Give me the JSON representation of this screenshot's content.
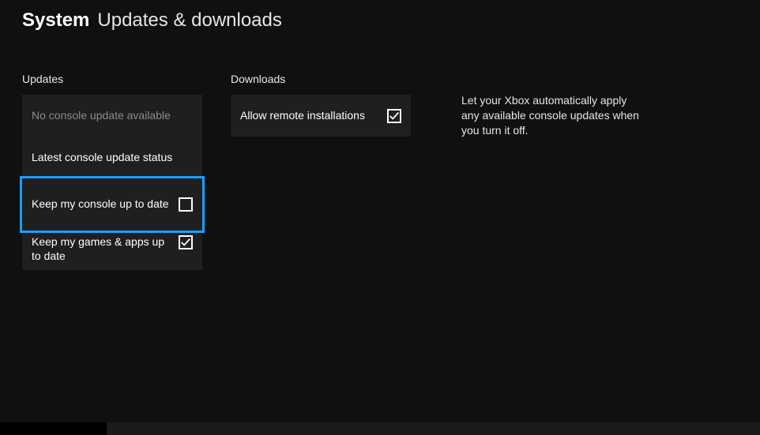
{
  "header": {
    "system": "System",
    "page": "Updates & downloads"
  },
  "updates": {
    "title": "Updates",
    "items": {
      "no_update": "No console update available",
      "latest_status": "Latest console update status",
      "keep_console": "Keep my console up to date",
      "keep_apps": "Keep my games & apps up to date"
    },
    "checked": {
      "keep_console": false,
      "keep_apps": true
    }
  },
  "downloads": {
    "title": "Downloads",
    "items": {
      "allow_remote": "Allow remote installations"
    },
    "checked": {
      "allow_remote": true
    }
  },
  "help": {
    "text": "Let your Xbox automatically apply any available console updates when you turn it off."
  }
}
